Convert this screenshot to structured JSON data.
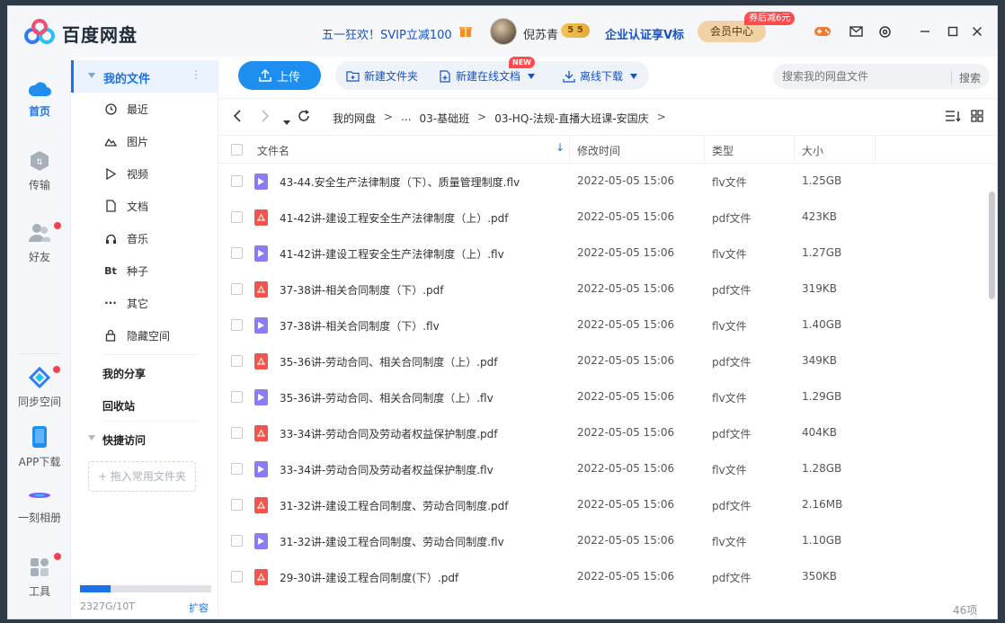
{
  "app": {
    "logo_text": "百度网盘",
    "promo": "五一狂欢！SVIP立减100",
    "username": "倪苏青",
    "coin_label": "5",
    "certify": "企业认证享V标",
    "vip_button": "会员中心",
    "vip_badge": "券后减6元",
    "icons": [
      "gift-icon",
      "game-icon",
      "mail-icon",
      "settings-icon",
      "minimize-icon",
      "maximize-icon",
      "close-icon"
    ]
  },
  "leftnav": [
    {
      "label": "首页",
      "icon": "home-cloud-icon",
      "active": true
    },
    {
      "label": "传输",
      "icon": "transfer-icon",
      "active": false
    },
    {
      "label": "好友",
      "icon": "friends-icon",
      "active": false
    },
    {
      "label": "同步空间",
      "icon": "sync-icon",
      "active": false
    },
    {
      "label": "APP下载",
      "icon": "phone-icon",
      "active": false
    },
    {
      "label": "一刻相册",
      "icon": "album-icon",
      "active": false
    },
    {
      "label": "工具",
      "icon": "tools-icon",
      "active": false
    }
  ],
  "sidebar": {
    "my_files": "我的文件",
    "items": [
      {
        "label": "最近",
        "icon": "clock-icon"
      },
      {
        "label": "图片",
        "icon": "image-icon"
      },
      {
        "label": "视频",
        "icon": "video-icon"
      },
      {
        "label": "文档",
        "icon": "document-icon"
      },
      {
        "label": "音乐",
        "icon": "headphones-icon"
      },
      {
        "label": "种子",
        "icon": "torrent-icon",
        "glyph": "Bt"
      },
      {
        "label": "其它",
        "icon": "more-icon"
      },
      {
        "label": "隐藏空间",
        "icon": "lock-icon"
      }
    ],
    "my_share": "我的分享",
    "recycle": "回收站",
    "quick_access": "快捷访问",
    "drop_hint": "+ 拖入常用文件夹",
    "quota_text": "2327G/10T",
    "quota_fraction": 0.23,
    "expand": "扩容"
  },
  "toolbar": {
    "upload": "上传",
    "new_folder": "新建文件夹",
    "new_online_doc": "新建在线文档",
    "new_badge": "NEW",
    "offline_download": "离线下载",
    "search_placeholder": "搜索我的网盘文件",
    "search_button": "搜索"
  },
  "path": {
    "crumbs": [
      "我的网盘",
      "...",
      "03-基础班",
      "03-HQ-法规-直播大班课-安国庆"
    ],
    "separator": ">"
  },
  "table": {
    "columns": {
      "name": "文件名",
      "time": "修改时间",
      "type": "类型",
      "size": "大小"
    },
    "rows": [
      {
        "name": "43-44.安全生产法律制度（下）、质量管理制度.flv",
        "time": "2022-05-05 15:06",
        "type": "flv文件",
        "size": "1.25GB",
        "kind": "flv"
      },
      {
        "name": "41-42讲-建设工程安全生产法律制度（上）.pdf",
        "time": "2022-05-05 15:06",
        "type": "pdf文件",
        "size": "423KB",
        "kind": "pdf"
      },
      {
        "name": "41-42讲-建设工程安全生产法律制度（上）.flv",
        "time": "2022-05-05 15:06",
        "type": "flv文件",
        "size": "1.27GB",
        "kind": "flv"
      },
      {
        "name": "37-38讲-相关合同制度（下）.pdf",
        "time": "2022-05-05 15:06",
        "type": "pdf文件",
        "size": "319KB",
        "kind": "pdf"
      },
      {
        "name": "37-38讲-相关合同制度（下）.flv",
        "time": "2022-05-05 15:06",
        "type": "flv文件",
        "size": "1.40GB",
        "kind": "flv"
      },
      {
        "name": "35-36讲-劳动合同、相关合同制度（上）.pdf",
        "time": "2022-05-05 15:06",
        "type": "pdf文件",
        "size": "349KB",
        "kind": "pdf"
      },
      {
        "name": "35-36讲-劳动合同、相关合同制度（上）.flv",
        "time": "2022-05-05 15:06",
        "type": "flv文件",
        "size": "1.29GB",
        "kind": "flv"
      },
      {
        "name": "33-34讲-劳动合同及劳动者权益保护制度.pdf",
        "time": "2022-05-05 15:06",
        "type": "pdf文件",
        "size": "404KB",
        "kind": "pdf"
      },
      {
        "name": "33-34讲-劳动合同及劳动者权益保护制度.flv",
        "time": "2022-05-05 15:06",
        "type": "flv文件",
        "size": "1.28GB",
        "kind": "flv"
      },
      {
        "name": "31-32讲-建设工程合同制度、劳动合同制度.pdf",
        "time": "2022-05-05 15:06",
        "type": "pdf文件",
        "size": "2.16MB",
        "kind": "pdf"
      },
      {
        "name": "31-32讲-建设工程合同制度、劳动合同制度.flv",
        "time": "2022-05-05 15:06",
        "type": "flv文件",
        "size": "1.10GB",
        "kind": "flv"
      },
      {
        "name": "29-30讲-建设工程合同制度(下）.pdf",
        "time": "2022-05-05 15:06",
        "type": "pdf文件",
        "size": "350KB",
        "kind": "pdf"
      }
    ],
    "count": "46项"
  },
  "colors": {
    "accent": "#1a73e8",
    "flv": "#8a7cf6",
    "pdf": "#f2554b",
    "badge": "#ff4d4f"
  }
}
